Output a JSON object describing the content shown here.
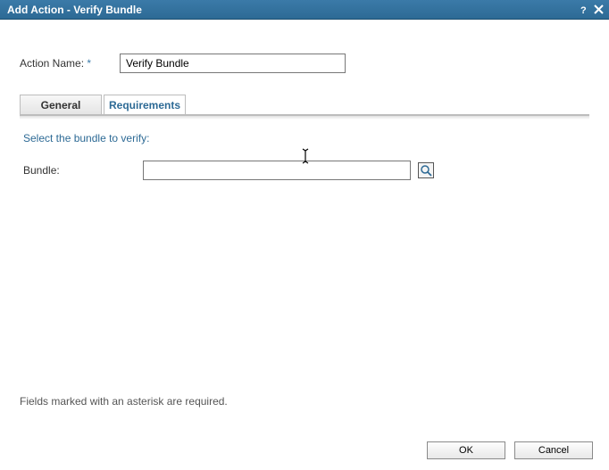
{
  "titlebar": {
    "title": "Add Action - Verify Bundle"
  },
  "form": {
    "action_name_label": "Action Name:",
    "action_name_value": "Verify Bundle",
    "asterisk": "*"
  },
  "tabs": {
    "general": "General",
    "requirements": "Requirements"
  },
  "panel": {
    "instruction": "Select the bundle to verify:",
    "bundle_label": "Bundle:",
    "bundle_value": ""
  },
  "footer": {
    "note": "Fields marked with an asterisk are required.",
    "ok": "OK",
    "cancel": "Cancel"
  }
}
